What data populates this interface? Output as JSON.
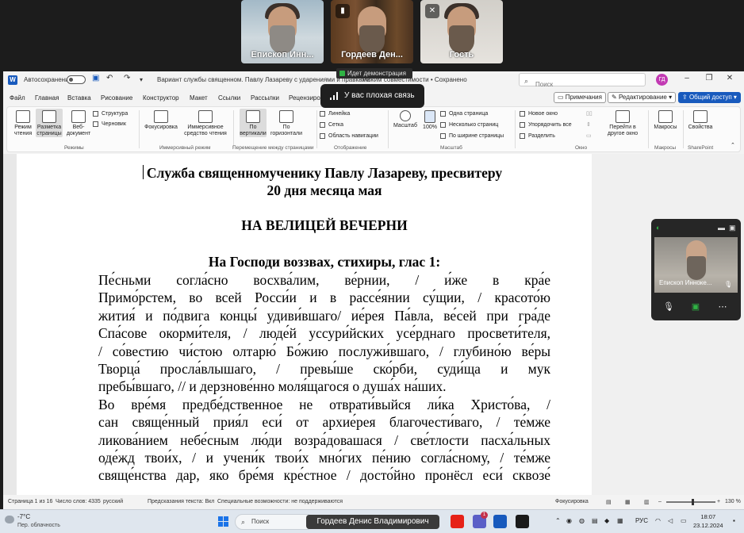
{
  "meeting": {
    "participants": [
      {
        "name": "Епископ Инн..."
      },
      {
        "name": "Гордеев Ден..."
      },
      {
        "name": "Гость"
      }
    ],
    "demo_banner": "Идет демонстрация",
    "toast": "У вас плохая связь",
    "self_view": {
      "name": "Епископ Инноке..."
    }
  },
  "word": {
    "autosave_label": "Автосохранение",
    "doc_title": "Вариант службы священном. Павлу Лазареву с ударениями и правками",
    "doc_title_suffix": "- Режим совместимости • Сохранено",
    "search_placeholder": "Поиск",
    "user_initials": "ГД",
    "tabs": [
      "Файл",
      "Главная",
      "Вставка",
      "Рисование",
      "Конструктор",
      "Макет",
      "Ссылки",
      "Рассылки",
      "Рецензиро"
    ],
    "comments_btn": "Примечания",
    "editing_btn": "Редактирование",
    "share_btn": "Общий доступ",
    "ribbon": {
      "mode_read": "Режим\nчтения",
      "mode_layout": "Разметка\nстраницы",
      "mode_web": "Веб-\nдокумент",
      "outline": "Структура",
      "draft": "Черновик",
      "group_modes": "Режимы",
      "focus": "Фокусировка",
      "immersive": "Иммерсивное\nсредство чтения",
      "group_immersive": "Иммерсивный режим",
      "vertical": "По\nвертикали",
      "horizontal": "По\nгоризонтали",
      "group_pages": "Перемещение между страницами",
      "ruler": "Линейка",
      "grid": "Сетка",
      "nav_pane": "Область навигации",
      "group_show": "Отображение",
      "zoom": "Масштаб",
      "zoom100": "100%",
      "one_page": "Одна страница",
      "multi_pages": "Несколько страниц",
      "page_width": "По ширине страницы",
      "group_zoom": "Масштаб",
      "new_window": "Новое окно",
      "arrange_all": "Упорядочить все",
      "split": "Разделить",
      "switch_windows": "Перейти в\nдругое окно",
      "group_window": "Окно",
      "macros": "Макросы",
      "group_macros": "Макросы",
      "properties": "Свойства",
      "group_sharepoint": "SharePoint"
    },
    "document": {
      "title1": "Служба священномученику Павлу Лазареву, пресвитеру",
      "title2": "20 дня месяца мая",
      "section": "НА ВЕЛИЦЕЙ ВЕЧЕРНИ",
      "subheading": "На Господи воззвах, стихиры, глас 1:",
      "lines": [
        "        Пе́сньми согла́сно восхва́лим, ве́рнии, / и́же в кра́е",
        "Примо́рстем, во всей Росси́и и в рассе́янии су́щии, / красото́ю",
        "жития́ и по́двига концы́ удиви́вшаго/ ие́рея Па́вла, ве́сей при гра́де",
        "Спа́сове окорми́теля, / люде́й уссури́йских усе́рднаго просвети́теля,",
        "/ со́вестию чи́стою олтарю́ Бо́жию послужи́вшаго, / глубино́ю ве́ры",
        "Творца́ просла́влышаго, / превы́ше ско́рби, суди́ща и мук",
        "пребы́вшаго, // и дерзнове́нно моля́щагося о душа́х на́ших.",
        "        Во вре́мя предбе́дственное не отврати́выйся ли́ка Христо́ва, /",
        "сан свяще́нный прия́л еси́ от архие́рея благочести́ваго, / те́мже",
        "ликова́нием небе́сным лю́ди возра́довашася / све́тлости пасха́льных",
        "оде́жд твои́х, / и учени́к твои́х мно́гих пе́нию согла́сному,  / те́мже",
        "свяще́нства дар, яко бре́мя кре́стное / досто́йно пронёсл еси́ сквозе́"
      ]
    },
    "status": {
      "page": "Страница 1 из 16",
      "words": "Число слов: 4335",
      "lang": "русский",
      "predict": "Предсказания текста: Вкл",
      "access": "Специальные возможности: не поддерживаются",
      "focus": "Фокусировка",
      "zoom": "130 %"
    }
  },
  "taskbar": {
    "temp": "-7°C",
    "weather": "Пер. облачность",
    "search": "Поиск",
    "presenter": "Гордеев Денис Владимирович",
    "lang": "РУС",
    "time": "18:07",
    "date": "23.12.2024",
    "badge_count": "1"
  }
}
